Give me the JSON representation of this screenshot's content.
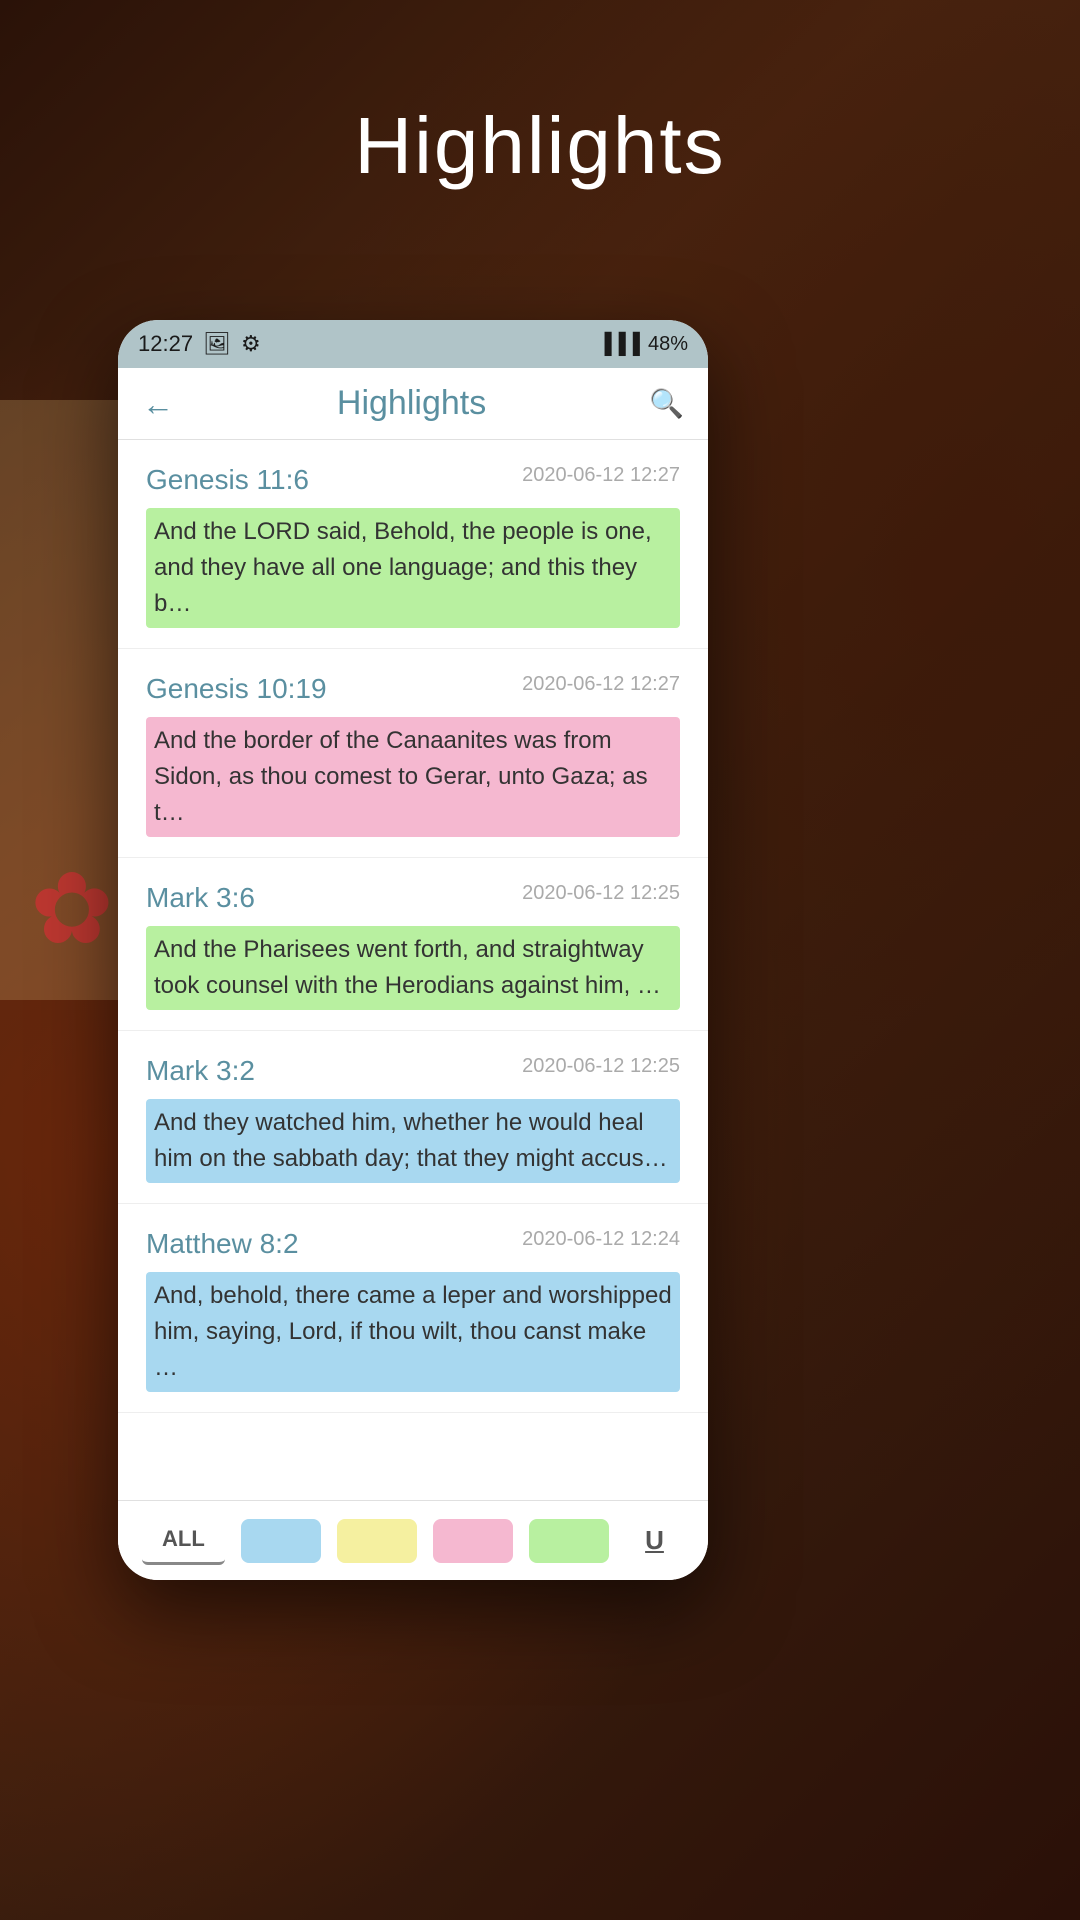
{
  "page": {
    "background_title": "Highlights",
    "app_title": "Highlights"
  },
  "status_bar": {
    "time": "12:27",
    "battery": "48%",
    "signal": "▐▐▐"
  },
  "header": {
    "back_label": "←",
    "title": "Highlights",
    "search_label": "🔍"
  },
  "highlights": [
    {
      "reference": "Genesis 11:6",
      "date": "2020-06-12 12:27",
      "text": "And the LORD said, Behold, the people is one, and they have all one language; and this they b…",
      "highlight_color": "green"
    },
    {
      "reference": "Genesis 10:19",
      "date": "2020-06-12 12:27",
      "text": "And the border of the Canaanites was from Sidon, as thou comest to Gerar, unto Gaza; as t…",
      "highlight_color": "pink"
    },
    {
      "reference": "Mark 3:6",
      "date": "2020-06-12 12:25",
      "text": "And the Pharisees went forth, and straightway took counsel with the Herodians against him, …",
      "highlight_color": "green"
    },
    {
      "reference": "Mark 3:2",
      "date": "2020-06-12 12:25",
      "text": "And they watched him, whether he would heal him on the sabbath day; that they might accus…",
      "highlight_color": "blue"
    },
    {
      "reference": "Matthew 8:2",
      "date": "2020-06-12 12:24",
      "text": "And, behold, there came a leper and worshipped him, saying, Lord, if thou wilt, thou canst make …",
      "highlight_color": "blue"
    }
  ],
  "filter_bar": {
    "all_label": "ALL",
    "underline_label": "U",
    "colors": [
      "blue",
      "yellow",
      "pink",
      "green"
    ]
  }
}
